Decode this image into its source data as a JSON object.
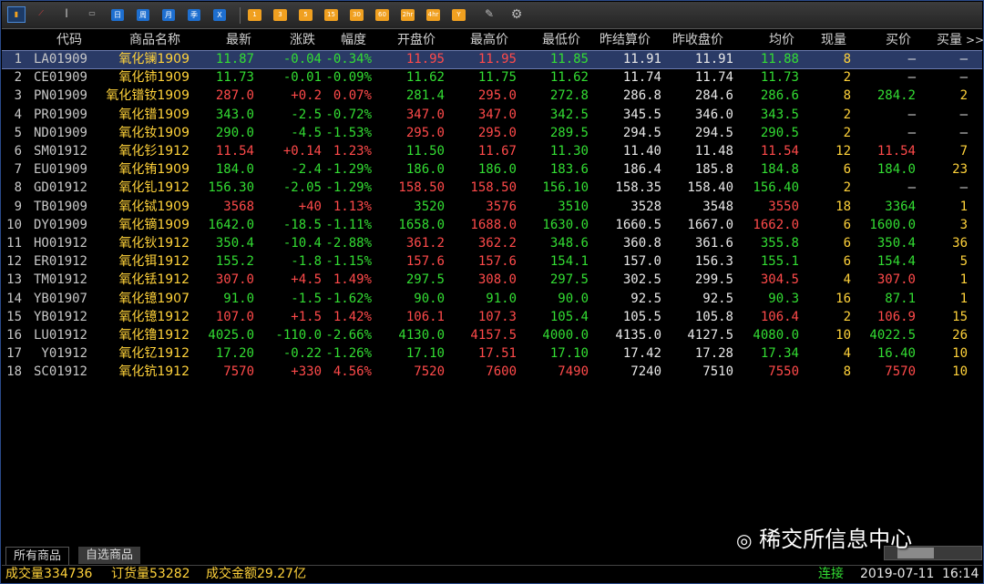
{
  "toolbar": {
    "buttons": [
      {
        "name": "bar-chart-icon",
        "label": "▮"
      },
      {
        "name": "line-chart-icon",
        "label": "⟋"
      },
      {
        "name": "candlestick-icon",
        "label": "┃"
      },
      {
        "name": "window-icon",
        "label": "▭"
      },
      {
        "name": "period-day-button",
        "label": "日"
      },
      {
        "name": "period-week-button",
        "label": "周"
      },
      {
        "name": "period-month-button",
        "label": "月"
      },
      {
        "name": "period-quarter-button",
        "label": "季"
      },
      {
        "name": "period-x-button",
        "label": "X"
      },
      {
        "name": "period-1-button",
        "label": "1"
      },
      {
        "name": "period-3-button",
        "label": "3"
      },
      {
        "name": "period-5-button",
        "label": "5"
      },
      {
        "name": "period-15-button",
        "label": "15"
      },
      {
        "name": "period-30-button",
        "label": "30"
      },
      {
        "name": "period-60-button",
        "label": "60"
      },
      {
        "name": "period-2hr-button",
        "label": "2hr"
      },
      {
        "name": "period-4hr-button",
        "label": "4hr"
      },
      {
        "name": "period-y-button",
        "label": "Y"
      },
      {
        "name": "draw-tool-icon",
        "label": "✎"
      },
      {
        "name": "settings-gear-icon",
        "label": "⚙"
      }
    ]
  },
  "header": {
    "code": "代码",
    "name": "商品名称",
    "latest": "最新",
    "change": "涨跌",
    "pct": "幅度",
    "open": "开盘价",
    "high": "最高价",
    "low": "最低价",
    "prev_settle": "昨结算价",
    "prev_close": "昨收盘价",
    "avg": "均价",
    "vol": "现量",
    "bid": "买价",
    "bid_vol": "买量",
    "more": ">>"
  },
  "rows": [
    {
      "n": "1",
      "code": "LA01909",
      "name": "氧化镧1909",
      "latest": "11.87",
      "chg": "-0.04",
      "pct": "-0.34%",
      "open": "11.95",
      "high": "11.95",
      "low": "11.85",
      "ps": "11.91",
      "pc": "11.91",
      "avg": "11.88",
      "vol": "8",
      "bid": "—",
      "bv": "—",
      "c": {
        "latest": "g",
        "chg": "g",
        "pct": "g",
        "open": "r",
        "high": "r",
        "low": "g",
        "avg": "g"
      }
    },
    {
      "n": "2",
      "code": "CE01909",
      "name": "氧化铈1909",
      "latest": "11.73",
      "chg": "-0.01",
      "pct": "-0.09%",
      "open": "11.62",
      "high": "11.75",
      "low": "11.62",
      "ps": "11.74",
      "pc": "11.74",
      "avg": "11.73",
      "vol": "2",
      "bid": "—",
      "bv": "—",
      "c": {
        "latest": "g",
        "chg": "g",
        "pct": "g",
        "open": "g",
        "high": "g",
        "low": "g",
        "avg": "g"
      }
    },
    {
      "n": "3",
      "code": "PN01909",
      "name": "氧化镨钕1909",
      "latest": "287.0",
      "chg": "+0.2",
      "pct": "0.07%",
      "open": "281.4",
      "high": "295.0",
      "low": "272.8",
      "ps": "286.8",
      "pc": "284.6",
      "avg": "286.6",
      "vol": "8",
      "bid": "284.2",
      "bv": "2",
      "c": {
        "latest": "r",
        "chg": "r",
        "pct": "r",
        "open": "g",
        "high": "r",
        "low": "g",
        "avg": "g",
        "bid": "g"
      }
    },
    {
      "n": "4",
      "code": "PR01909",
      "name": "氧化镨1909",
      "latest": "343.0",
      "chg": "-2.5",
      "pct": "-0.72%",
      "open": "347.0",
      "high": "347.0",
      "low": "342.5",
      "ps": "345.5",
      "pc": "346.0",
      "avg": "343.5",
      "vol": "2",
      "bid": "—",
      "bv": "—",
      "c": {
        "latest": "g",
        "chg": "g",
        "pct": "g",
        "open": "r",
        "high": "r",
        "low": "g",
        "avg": "g"
      }
    },
    {
      "n": "5",
      "code": "ND01909",
      "name": "氧化钕1909",
      "latest": "290.0",
      "chg": "-4.5",
      "pct": "-1.53%",
      "open": "295.0",
      "high": "295.0",
      "low": "289.5",
      "ps": "294.5",
      "pc": "294.5",
      "avg": "290.5",
      "vol": "2",
      "bid": "—",
      "bv": "—",
      "c": {
        "latest": "g",
        "chg": "g",
        "pct": "g",
        "open": "r",
        "high": "r",
        "low": "g",
        "avg": "g"
      }
    },
    {
      "n": "6",
      "code": "SM01912",
      "name": "氧化钐1912",
      "latest": "11.54",
      "chg": "+0.14",
      "pct": "1.23%",
      "open": "11.50",
      "high": "11.67",
      "low": "11.30",
      "ps": "11.40",
      "pc": "11.48",
      "avg": "11.54",
      "vol": "12",
      "bid": "11.54",
      "bv": "7",
      "c": {
        "latest": "r",
        "chg": "r",
        "pct": "r",
        "open": "g",
        "high": "r",
        "low": "g",
        "avg": "r",
        "bid": "r"
      }
    },
    {
      "n": "7",
      "code": "EU01909",
      "name": "氧化铕1909",
      "latest": "184.0",
      "chg": "-2.4",
      "pct": "-1.29%",
      "open": "186.0",
      "high": "186.0",
      "low": "183.6",
      "ps": "186.4",
      "pc": "185.8",
      "avg": "184.8",
      "vol": "6",
      "bid": "184.0",
      "bv": "23",
      "c": {
        "latest": "g",
        "chg": "g",
        "pct": "g",
        "open": "g",
        "high": "g",
        "low": "g",
        "avg": "g",
        "bid": "g"
      }
    },
    {
      "n": "8",
      "code": "GD01912",
      "name": "氧化钆1912",
      "latest": "156.30",
      "chg": "-2.05",
      "pct": "-1.29%",
      "open": "158.50",
      "high": "158.50",
      "low": "156.10",
      "ps": "158.35",
      "pc": "158.40",
      "avg": "156.40",
      "vol": "2",
      "bid": "—",
      "bv": "—",
      "c": {
        "latest": "g",
        "chg": "g",
        "pct": "g",
        "open": "r",
        "high": "r",
        "low": "g",
        "avg": "g"
      }
    },
    {
      "n": "9",
      "code": "TB01909",
      "name": "氧化铽1909",
      "latest": "3568",
      "chg": "+40",
      "pct": "1.13%",
      "open": "3520",
      "high": "3576",
      "low": "3510",
      "ps": "3528",
      "pc": "3548",
      "avg": "3550",
      "vol": "18",
      "bid": "3364",
      "bv": "1",
      "c": {
        "latest": "r",
        "chg": "r",
        "pct": "r",
        "open": "g",
        "high": "r",
        "low": "g",
        "avg": "r",
        "bid": "g"
      }
    },
    {
      "n": "10",
      "code": "DY01909",
      "name": "氧化镝1909",
      "latest": "1642.0",
      "chg": "-18.5",
      "pct": "-1.11%",
      "open": "1658.0",
      "high": "1688.0",
      "low": "1630.0",
      "ps": "1660.5",
      "pc": "1667.0",
      "avg": "1662.0",
      "vol": "6",
      "bid": "1600.0",
      "bv": "3",
      "c": {
        "latest": "g",
        "chg": "g",
        "pct": "g",
        "open": "g",
        "high": "r",
        "low": "g",
        "avg": "r",
        "bid": "g"
      }
    },
    {
      "n": "11",
      "code": "HO01912",
      "name": "氧化钬1912",
      "latest": "350.4",
      "chg": "-10.4",
      "pct": "-2.88%",
      "open": "361.2",
      "high": "362.2",
      "low": "348.6",
      "ps": "360.8",
      "pc": "361.6",
      "avg": "355.8",
      "vol": "6",
      "bid": "350.4",
      "bv": "36",
      "c": {
        "latest": "g",
        "chg": "g",
        "pct": "g",
        "open": "r",
        "high": "r",
        "low": "g",
        "avg": "g",
        "bid": "g"
      }
    },
    {
      "n": "12",
      "code": "ER01912",
      "name": "氧化铒1912",
      "latest": "155.2",
      "chg": "-1.8",
      "pct": "-1.15%",
      "open": "157.6",
      "high": "157.6",
      "low": "154.1",
      "ps": "157.0",
      "pc": "156.3",
      "avg": "155.1",
      "vol": "6",
      "bid": "154.4",
      "bv": "5",
      "c": {
        "latest": "g",
        "chg": "g",
        "pct": "g",
        "open": "r",
        "high": "r",
        "low": "g",
        "avg": "g",
        "bid": "g"
      }
    },
    {
      "n": "13",
      "code": "TM01912",
      "name": "氧化铥1912",
      "latest": "307.0",
      "chg": "+4.5",
      "pct": "1.49%",
      "open": "297.5",
      "high": "308.0",
      "low": "297.5",
      "ps": "302.5",
      "pc": "299.5",
      "avg": "304.5",
      "vol": "4",
      "bid": "307.0",
      "bv": "1",
      "c": {
        "latest": "r",
        "chg": "r",
        "pct": "r",
        "open": "g",
        "high": "r",
        "low": "g",
        "avg": "r",
        "bid": "r"
      }
    },
    {
      "n": "14",
      "code": "YB01907",
      "name": "氧化镱1907",
      "latest": "91.0",
      "chg": "-1.5",
      "pct": "-1.62%",
      "open": "90.0",
      "high": "91.0",
      "low": "90.0",
      "ps": "92.5",
      "pc": "92.5",
      "avg": "90.3",
      "vol": "16",
      "bid": "87.1",
      "bv": "1",
      "c": {
        "latest": "g",
        "chg": "g",
        "pct": "g",
        "open": "g",
        "high": "g",
        "low": "g",
        "avg": "g",
        "bid": "g"
      }
    },
    {
      "n": "15",
      "code": "YB01912",
      "name": "氧化镱1912",
      "latest": "107.0",
      "chg": "+1.5",
      "pct": "1.42%",
      "open": "106.1",
      "high": "107.3",
      "low": "105.4",
      "ps": "105.5",
      "pc": "105.8",
      "avg": "106.4",
      "vol": "2",
      "bid": "106.9",
      "bv": "15",
      "c": {
        "latest": "r",
        "chg": "r",
        "pct": "r",
        "open": "r",
        "high": "r",
        "low": "g",
        "avg": "r",
        "bid": "r"
      }
    },
    {
      "n": "16",
      "code": "LU01912",
      "name": "氧化镥1912",
      "latest": "4025.0",
      "chg": "-110.0",
      "pct": "-2.66%",
      "open": "4130.0",
      "high": "4157.5",
      "low": "4000.0",
      "ps": "4135.0",
      "pc": "4127.5",
      "avg": "4080.0",
      "vol": "10",
      "bid": "4022.5",
      "bv": "26",
      "c": {
        "latest": "g",
        "chg": "g",
        "pct": "g",
        "open": "g",
        "high": "r",
        "low": "g",
        "avg": "g",
        "bid": "g"
      }
    },
    {
      "n": "17",
      "code": "Y01912",
      "name": "氧化钇1912",
      "latest": "17.20",
      "chg": "-0.22",
      "pct": "-1.26%",
      "open": "17.10",
      "high": "17.51",
      "low": "17.10",
      "ps": "17.42",
      "pc": "17.28",
      "avg": "17.34",
      "vol": "4",
      "bid": "16.40",
      "bv": "10",
      "c": {
        "latest": "g",
        "chg": "g",
        "pct": "g",
        "open": "g",
        "high": "r",
        "low": "g",
        "avg": "g",
        "bid": "g"
      }
    },
    {
      "n": "18",
      "code": "SC01912",
      "name": "氧化钪1912",
      "latest": "7570",
      "chg": "+330",
      "pct": "4.56%",
      "open": "7520",
      "high": "7600",
      "low": "7490",
      "ps": "7240",
      "pc": "7510",
      "avg": "7550",
      "vol": "8",
      "bid": "7570",
      "bv": "10",
      "c": {
        "latest": "r",
        "chg": "r",
        "pct": "r",
        "open": "r",
        "high": "r",
        "low": "r",
        "avg": "r",
        "bid": "r"
      }
    }
  ],
  "tabs": {
    "all": "所有商品",
    "fav": "自选商品"
  },
  "status": {
    "volume": "成交量334736",
    "orders": "订货量53282",
    "amount": "成交金额29.27亿",
    "connection": "连接",
    "date": "2019-07-11",
    "time": "16:14"
  },
  "watermark": "稀交所信息中心"
}
